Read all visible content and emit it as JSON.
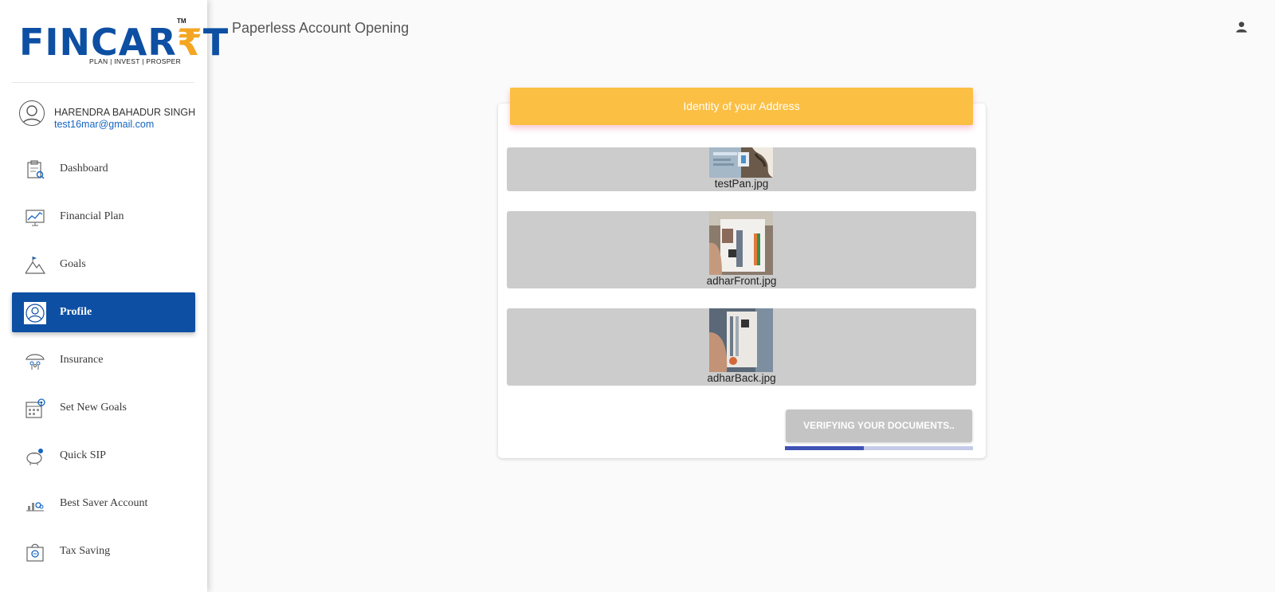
{
  "brand": {
    "logo_main": "FINCAR",
    "logo_accent": "₹",
    "logo_end": "T",
    "logo_tm": "TM",
    "tagline": "PLAN | INVEST | PROSPER"
  },
  "user": {
    "name": "HARENDRA BAHADUR SINGH",
    "email": "test16mar@gmail.com"
  },
  "nav": {
    "items": [
      {
        "label": "Dashboard",
        "icon": "dashboard-icon",
        "active": false
      },
      {
        "label": "Financial Plan",
        "icon": "chart-board-icon",
        "active": false
      },
      {
        "label": "Goals",
        "icon": "mountain-flag-icon",
        "active": false
      },
      {
        "label": "Profile",
        "icon": "profile-icon",
        "active": true
      },
      {
        "label": "Insurance",
        "icon": "umbrella-family-icon",
        "active": false
      },
      {
        "label": "Set New Goals",
        "icon": "calendar-target-icon",
        "active": false
      },
      {
        "label": "Quick SIP",
        "icon": "piggy-bank-icon",
        "active": false
      },
      {
        "label": "Best Saver Account",
        "icon": "savings-chart-icon",
        "active": false
      },
      {
        "label": "Tax Saving",
        "icon": "tax-doc-icon",
        "active": false
      }
    ]
  },
  "header": {
    "title": "Paperless Account Opening",
    "account_icon": "person-icon"
  },
  "card": {
    "title": "Identity of your Address",
    "documents": [
      {
        "filename": "testPan.jpg"
      },
      {
        "filename": "adharFront.jpg"
      },
      {
        "filename": "adharBack.jpg"
      }
    ],
    "verify_button": "VERIFYING YOUR DOCUMENTS..",
    "progress": 0.42
  },
  "colors": {
    "brand_blue": "#0d4fa3",
    "accent_orange": "#f4a623",
    "card_header": "#fbbf44",
    "progress": "#3f51b5"
  }
}
